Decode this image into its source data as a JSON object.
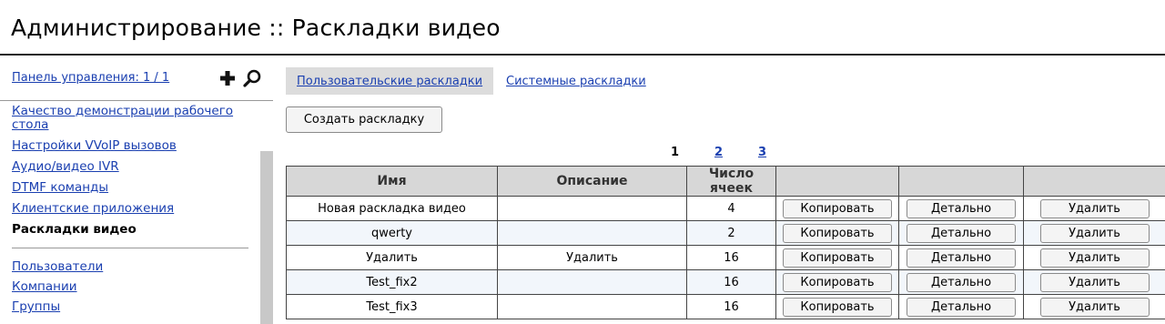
{
  "page_title": "Администрирование :: Раскладки видео",
  "sidebar": {
    "panel_link": "Панель управления: 1 / 1",
    "items": [
      {
        "label": "Качество демонстрации рабочего стола",
        "active": false
      },
      {
        "label": "Настройки VVoIP вызовов",
        "active": false
      },
      {
        "label": "Аудио/видео IVR",
        "active": false
      },
      {
        "label": "DTMF команды",
        "active": false
      },
      {
        "label": "Клиентские приложения",
        "active": false
      },
      {
        "label": "Раскладки видео",
        "active": true
      }
    ],
    "items2": [
      {
        "label": "Пользователи"
      },
      {
        "label": "Компании"
      },
      {
        "label": "Группы"
      }
    ]
  },
  "tabs": [
    {
      "label": "Пользовательские раскладки",
      "active": true
    },
    {
      "label": "Системные раскладки",
      "active": false
    }
  ],
  "create_button": "Создать раскладку",
  "pager": {
    "current": "1",
    "pages": [
      "2",
      "3"
    ]
  },
  "table": {
    "headers": [
      "Имя",
      "Описание",
      "Число ячеек",
      "",
      "",
      ""
    ],
    "rows": [
      {
        "name": "Новая раскладка видео",
        "description": "",
        "cells": "4",
        "copy": "Копировать",
        "details": "Детально",
        "delete": "Удалить"
      },
      {
        "name": "qwerty",
        "description": "",
        "cells": "2",
        "copy": "Копировать",
        "details": "Детально",
        "delete": "Удалить"
      },
      {
        "name": "Удалить",
        "description": "Удалить",
        "cells": "16",
        "copy": "Копировать",
        "details": "Детально",
        "delete": "Удалить"
      },
      {
        "name": "Test_fix2",
        "description": "",
        "cells": "16",
        "copy": "Копировать",
        "details": "Детально",
        "delete": "Удалить"
      },
      {
        "name": "Test_fix3",
        "description": "",
        "cells": "16",
        "copy": "Копировать",
        "details": "Детально",
        "delete": "Удалить"
      }
    ]
  },
  "colors": {
    "link": "#1a3fb0",
    "header_bg": "#d7d7d7",
    "alt_row_bg": "#f2f6fb"
  }
}
